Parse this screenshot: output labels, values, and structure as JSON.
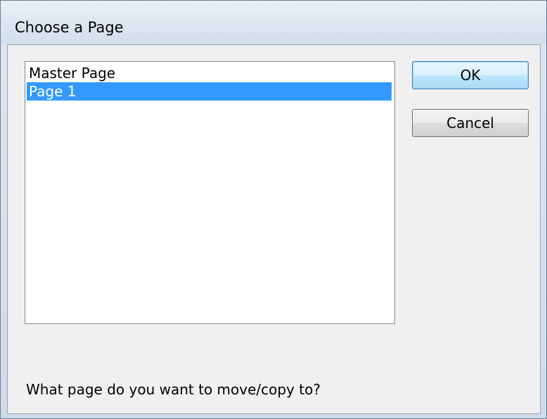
{
  "dialog": {
    "title": "Choose a Page",
    "pages": [
      {
        "label": "Master Page",
        "selected": false
      },
      {
        "label": "Page 1",
        "selected": true
      }
    ],
    "ok_label": "OK",
    "cancel_label": "Cancel",
    "prompt": "What page do you want to move/copy to?"
  },
  "colors": {
    "selection": "#3399ff",
    "selection_text": "#ffffff"
  }
}
